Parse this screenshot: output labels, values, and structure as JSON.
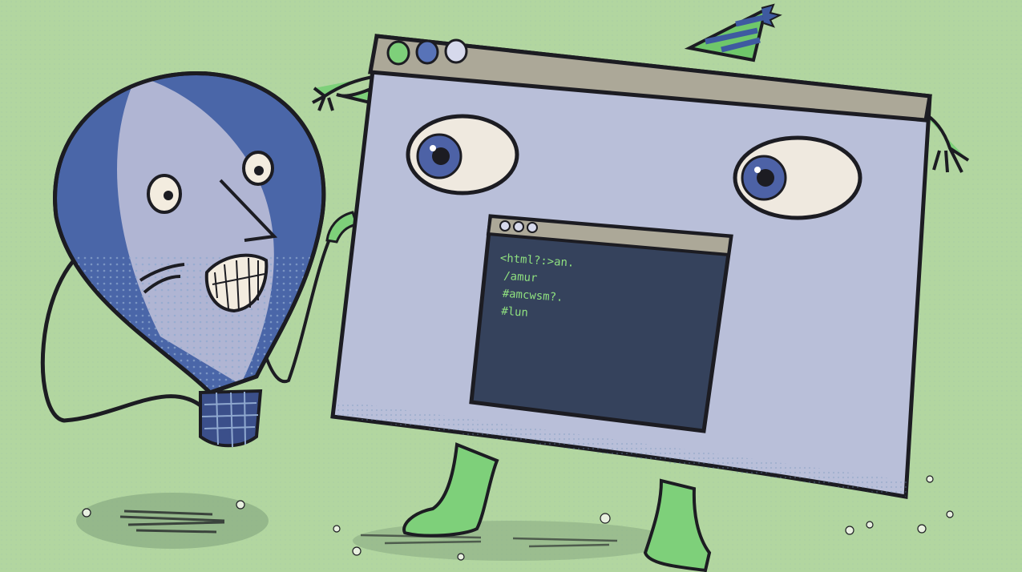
{
  "illustration": {
    "code_lines": [
      "<html?:>an.",
      "/amur",
      "#amcwsm?.",
      "#lun"
    ]
  },
  "colors": {
    "background": "#b2d6a0",
    "browser_body": "#b9bfd9",
    "browser_titlebar": "#aca898",
    "balloon_blue": "#4a66a8",
    "balloon_light": "#b0b5d3",
    "creature_green": "#7ed07a",
    "terminal_bg": "#35425c",
    "terminal_text": "#8fe07f",
    "outline": "#1c1c22"
  }
}
